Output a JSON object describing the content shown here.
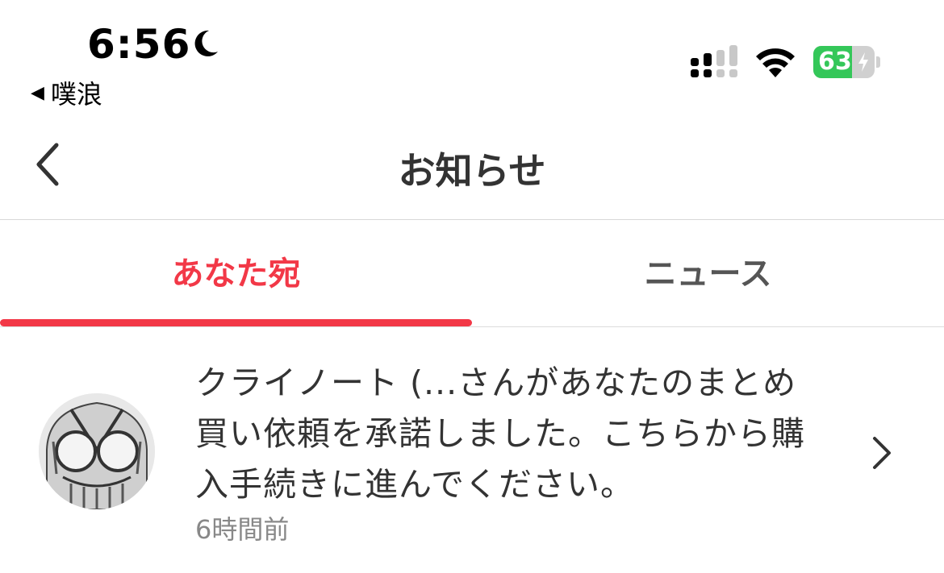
{
  "status_bar": {
    "time": "6:56",
    "back_app": "噗浪",
    "battery_percent": 63,
    "battery_label": "63",
    "charging": true
  },
  "nav": {
    "title": "お知らせ"
  },
  "tabs": [
    {
      "label": "あなた宛",
      "active": true
    },
    {
      "label": "ニュース",
      "active": false
    }
  ],
  "notifications": [
    {
      "message": "クライノート (...さんがあなたのまとめ買い依頼を承諾しました。こちらから購入手続きに進んでください。",
      "time": "6時間前"
    }
  ],
  "colors": {
    "accent": "#f23847",
    "battery_green": "#34c759",
    "text": "#333333",
    "muted": "#888888"
  },
  "icons": [
    "moon-icon",
    "signal-icon",
    "wifi-icon",
    "bolt-icon",
    "back-chevron-icon",
    "chevron-right-icon"
  ]
}
